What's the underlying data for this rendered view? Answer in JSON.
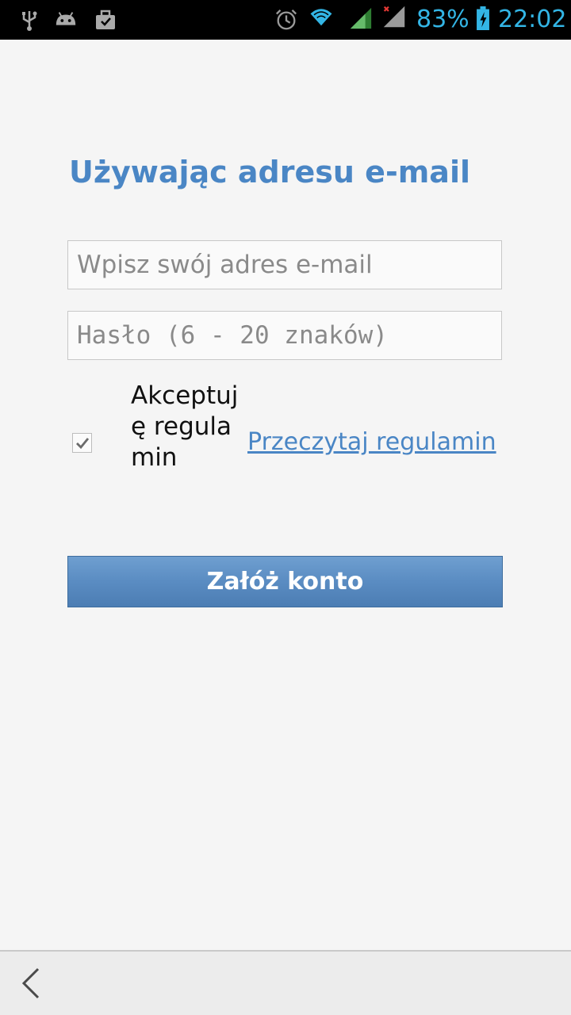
{
  "status_bar": {
    "icons_left": [
      "usb-icon",
      "android-debug-icon",
      "briefcase-icon"
    ],
    "icons_right": [
      "alarm-icon",
      "wifi-icon",
      "signal-icon",
      "signal-no-data-icon",
      "battery-charging-icon"
    ],
    "battery": "83%",
    "time": "22:02",
    "accent_color": "#33b5e5"
  },
  "form": {
    "title": "Używając adresu e-mail",
    "title_color": "#4a86c5",
    "email_placeholder": "Wpisz swój adres e-mail",
    "email_value": "",
    "password_placeholder": "Hasło (6 - 20 znaków)",
    "password_value": "",
    "accept_checked": true,
    "accept_label": "Akceptuję regulamin",
    "terms_link": "Przeczytaj regulamin",
    "submit_label": "Załóż konto"
  },
  "nav": {
    "back_icon": "back-chevron-icon"
  }
}
